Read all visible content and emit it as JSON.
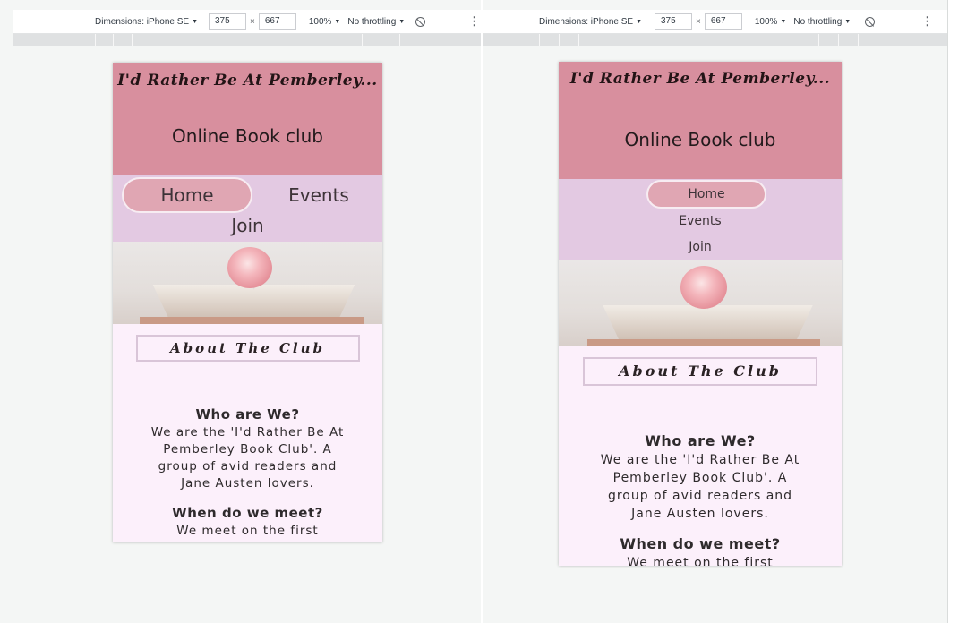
{
  "devtools": {
    "dimensions_label": "Dimensions: iPhone SE",
    "width": "375",
    "times": "×",
    "height": "667",
    "zoom": "100%",
    "throttling": "No throttling",
    "rotate_icon": "block-icon",
    "more_icon": "kebab-icon",
    "caret": "▼",
    "kebab": "⋮"
  },
  "site": {
    "logo": "I'd Rather Be At Pemberley...",
    "title": "Online Book club",
    "nav": [
      "Home",
      "Events",
      "Join"
    ],
    "hero_alt": "open book with pink rose",
    "about_heading": "About The Club",
    "q1": "Who are We?",
    "a1": "We are the 'I'd Rather Be At Pemberley Book Club'. A group of avid readers and Jane Austen lovers.",
    "q2": "When do we meet?",
    "a2_partial": "We meet on the first"
  },
  "colors": {
    "header": "#d88f9e",
    "nav": "#e3c9e2",
    "nav_active": "#e0a6b3",
    "content": "#fcf0fb"
  }
}
